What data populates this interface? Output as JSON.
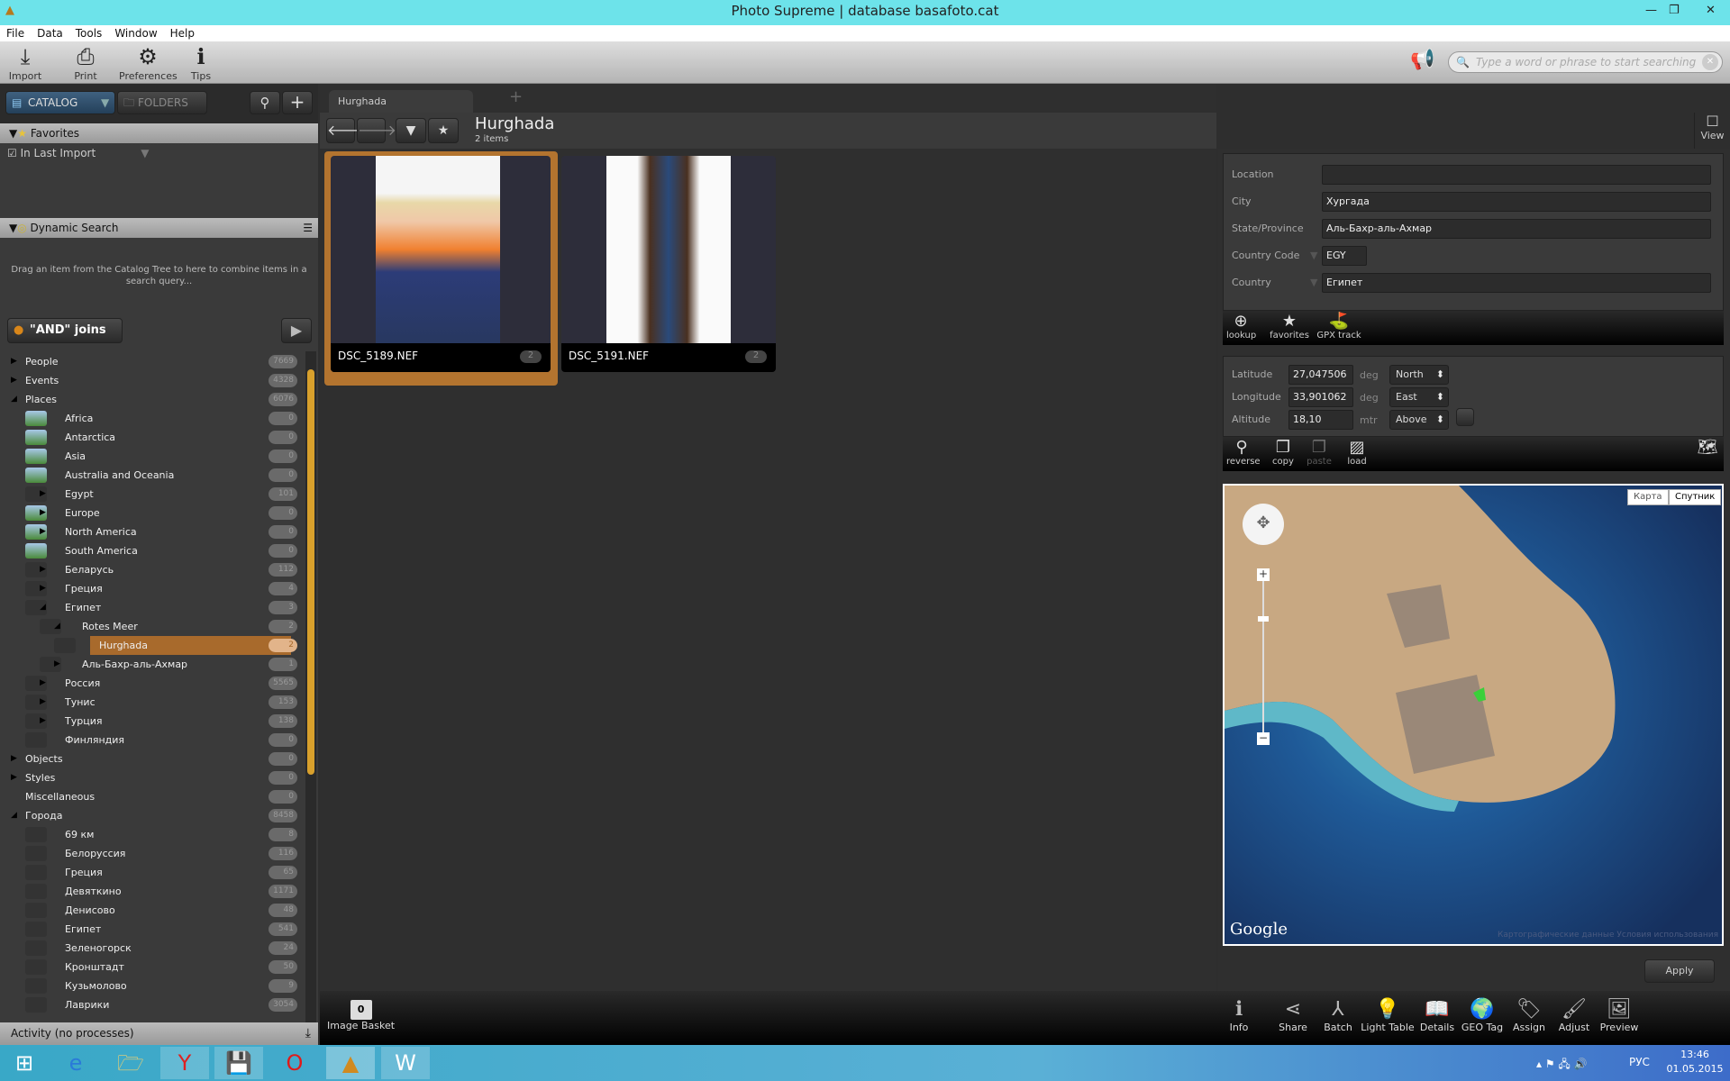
{
  "window": {
    "title": "Photo Supreme | database basafoto.cat"
  },
  "menu": [
    "File",
    "Data",
    "Tools",
    "Window",
    "Help"
  ],
  "toolbar": [
    {
      "label": "Import",
      "icon": "import-icon"
    },
    {
      "label": "Print",
      "icon": "print-icon"
    },
    {
      "label": "Preferences",
      "icon": "gear-icon"
    },
    {
      "label": "Tips",
      "icon": "tips-icon"
    }
  ],
  "search": {
    "placeholder": "Type a word or phrase to start searching"
  },
  "left": {
    "catalog_label": "CATALOG",
    "folders_label": "FOLDERS",
    "favorites_title": "Favorites",
    "favorites_items": [
      "In Last Import"
    ],
    "dynamic_title": "Dynamic Search",
    "dynamic_hint": "Drag an item from the Catalog Tree to here to combine items in a search query...",
    "and_joins": "\"AND\" joins",
    "tree": [
      {
        "label": "People",
        "count": "7669",
        "level": 0,
        "exp": "right"
      },
      {
        "label": "Events",
        "count": "4328",
        "level": 0,
        "exp": "right"
      },
      {
        "label": "Places",
        "count": "6076",
        "level": 0,
        "exp": "down"
      },
      {
        "label": "Africa",
        "count": "0",
        "level": 1,
        "map": true
      },
      {
        "label": "Antarctica",
        "count": "0",
        "level": 1,
        "map": true
      },
      {
        "label": "Asia",
        "count": "0",
        "level": 1,
        "map": true
      },
      {
        "label": "Australia and Oceania",
        "count": "0",
        "level": 1,
        "map": true
      },
      {
        "label": "Egypt",
        "count": "101",
        "level": 1,
        "exp": "right"
      },
      {
        "label": "Europe",
        "count": "0",
        "level": 1,
        "exp": "right",
        "map": true
      },
      {
        "label": "North America",
        "count": "0",
        "level": 1,
        "exp": "right",
        "map": true
      },
      {
        "label": "South America",
        "count": "0",
        "level": 1,
        "map": true
      },
      {
        "label": "Беларусь",
        "count": "112",
        "level": 1,
        "exp": "right"
      },
      {
        "label": "Греция",
        "count": "4",
        "level": 1,
        "exp": "right"
      },
      {
        "label": "Египет",
        "count": "3",
        "level": 1,
        "exp": "down"
      },
      {
        "label": "Rotes Meer",
        "count": "2",
        "level": 2,
        "exp": "down"
      },
      {
        "label": "Hurghada",
        "count": "2",
        "level": 3,
        "selected": true
      },
      {
        "label": "Аль-Бахр-аль-Ахмар",
        "count": "1",
        "level": 2,
        "exp": "right"
      },
      {
        "label": "Россия",
        "count": "5565",
        "level": 1,
        "exp": "right"
      },
      {
        "label": "Тунис",
        "count": "153",
        "level": 1,
        "exp": "right"
      },
      {
        "label": "Турция",
        "count": "138",
        "level": 1,
        "exp": "right"
      },
      {
        "label": "Финляндия",
        "count": "0",
        "level": 1
      },
      {
        "label": "Objects",
        "count": "0",
        "level": 0,
        "exp": "right"
      },
      {
        "label": "Styles",
        "count": "0",
        "level": 0,
        "exp": "right"
      },
      {
        "label": "Miscellaneous",
        "count": "0",
        "level": 0
      },
      {
        "label": "Города",
        "count": "8458",
        "level": 0,
        "exp": "down"
      },
      {
        "label": "69 км",
        "count": "8",
        "level": 1
      },
      {
        "label": "Белоруссия",
        "count": "116",
        "level": 1
      },
      {
        "label": "Греция",
        "count": "65",
        "level": 1
      },
      {
        "label": "Девяткино",
        "count": "1171",
        "level": 1
      },
      {
        "label": "Денисово",
        "count": "48",
        "level": 1
      },
      {
        "label": "Египет",
        "count": "541",
        "level": 1
      },
      {
        "label": "Зеленогорск",
        "count": "24",
        "level": 1
      },
      {
        "label": "Кронштадт",
        "count": "50",
        "level": 1
      },
      {
        "label": "Кузьмолово",
        "count": "9",
        "level": 1
      },
      {
        "label": "Лаврики",
        "count": "3054",
        "level": 1
      }
    ],
    "activity": "Activity (no processes)"
  },
  "center": {
    "tab": "Hurghada",
    "title": "Hurghada",
    "subtitle": "2 items",
    "thumbs": [
      {
        "name": "DSC_5189.NEF",
        "badge": "2",
        "selected": true
      },
      {
        "name": "DSC_5191.NEF",
        "badge": "2"
      }
    ],
    "view_label": "View",
    "basket_label": "Image Basket",
    "basket_count": "0"
  },
  "right": {
    "fields": [
      {
        "label": "Location",
        "value": ""
      },
      {
        "label": "City",
        "value": "Хургада"
      },
      {
        "label": "State/Province",
        "value": "Аль-Бахр-аль-Ахмар"
      },
      {
        "label": "Country Code",
        "value": "EGY"
      },
      {
        "label": "Country",
        "value": "Египет"
      }
    ],
    "tools1": [
      "lookup",
      "favorites",
      "GPX track"
    ],
    "gps": [
      {
        "label": "Latitude",
        "value": "27,047506",
        "unit": "deg",
        "ref": "North"
      },
      {
        "label": "Longitude",
        "value": "33,901062",
        "unit": "deg",
        "ref": "East"
      },
      {
        "label": "Altitude",
        "value": "18,10",
        "unit": "mtr",
        "ref": "Above"
      }
    ],
    "tools2": [
      "reverse",
      "copy",
      "paste",
      "load"
    ],
    "map": {
      "type_map": "Карта",
      "type_sat": "Спутник",
      "google": "Google",
      "attribution": "Картографические данные   Условия использования"
    },
    "apply": "Apply"
  },
  "bottom": [
    "Info",
    "Share",
    "Batch",
    "Light Table",
    "Details",
    "GEO Tag",
    "Assign",
    "Adjust",
    "Preview"
  ],
  "tray": {
    "lang": "РУС",
    "time": "13:46",
    "date": "01.05.2015"
  },
  "colors": {
    "accent": "#a86a2c",
    "titlebar": "#6de3ea"
  }
}
